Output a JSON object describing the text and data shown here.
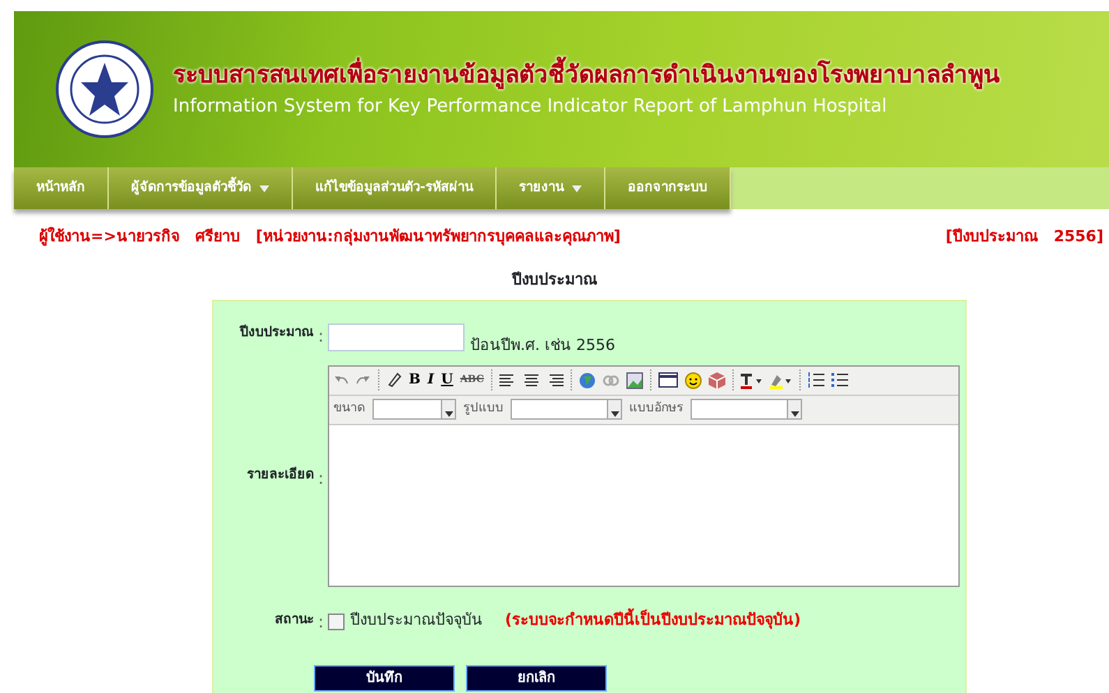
{
  "header": {
    "title_thai": "ระบบสารสนเทศเพื่อรายงานข้อมูลตัวชี้วัดผลการดำเนินงานของโรงพยาบาลลำพูน",
    "title_english": "Information System for Key Performance Indicator Report of Lamphun Hospital"
  },
  "menu": [
    {
      "label": "หน้าหลัก",
      "has_dropdown": false
    },
    {
      "label": "ผู้จัดการข้อมูลตัวชี้วัด",
      "has_dropdown": true
    },
    {
      "label": "แก้ไขข้อมูลส่วนตัว-รหัสผ่าน",
      "has_dropdown": false
    },
    {
      "label": "รายงาน",
      "has_dropdown": true
    },
    {
      "label": "ออกจากระบบ",
      "has_dropdown": false
    }
  ],
  "user_info": "ผู้ใช้งาน=>นายวรกิจ   ศรียาบ   [หน่วยงาน:กลุ่มงานพัฒนาทรัพยากรบุคคลและคุณภาพ]",
  "budget_year_info": "[ปีงบประมาณ   2556]",
  "form": {
    "title": "ปีงบประมาณ",
    "year_label": "ปีงบประมาณ",
    "year_hint": "ป้อนปีพ.ศ. เช่น   2556",
    "detail_label": "รายละเอียด",
    "toolbar_text_buttons": [
      {
        "label": "B"
      },
      {
        "label": "I"
      },
      {
        "label": "U"
      },
      {
        "label": "ABC"
      }
    ],
    "toolbar_dropdowns": [
      {
        "label": "ขนาด"
      },
      {
        "label": "รูปแบบ"
      },
      {
        "label": "แบบอักษร"
      }
    ],
    "status_label": "สถานะ",
    "separator": ":",
    "current_year": {
      "label": "ปีงบประมาณปัจจุบัน",
      "checked": false
    },
    "current_year_note": "(ระบบจะกำหนดปีนี้เป็นปีงบประมาณปัจจุบัน)",
    "buttons": [
      {
        "label": "บันทึก"
      },
      {
        "label": "ยกเลิก"
      }
    ]
  }
}
